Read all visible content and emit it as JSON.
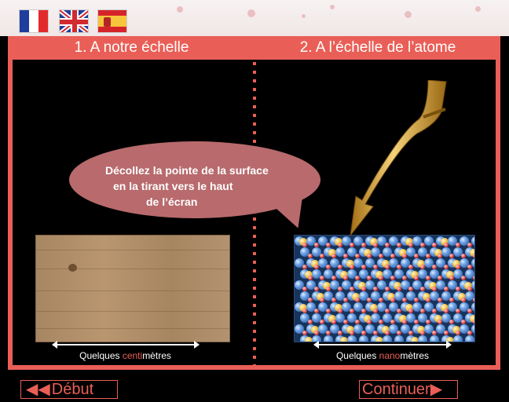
{
  "language_flags": [
    {
      "name": "French",
      "icon": "france-flag"
    },
    {
      "name": "English",
      "icon": "uk-flag"
    },
    {
      "name": "Spanish",
      "icon": "spain-flag"
    }
  ],
  "panels": {
    "left_title": "1. A notre échelle",
    "right_title": "2. A l’échelle de l’atome"
  },
  "instruction": {
    "line1": "Décollez la pointe de la surface",
    "line2": "en la tirant vers le haut",
    "line3": "de l’écran"
  },
  "captions": {
    "left_prefix": "Quelques ",
    "left_highlight": "centi",
    "left_suffix": "mètres",
    "right_prefix": "Quelques ",
    "right_highlight": "nano",
    "right_suffix": "mètres"
  },
  "navigation": {
    "back_label": "Début",
    "back_icon": "double-chevron-left-icon",
    "next_label": "Continuer",
    "next_icon": "triangle-right-icon"
  },
  "colors": {
    "accent": "#e95f57",
    "bubble": "#b86a6d"
  }
}
